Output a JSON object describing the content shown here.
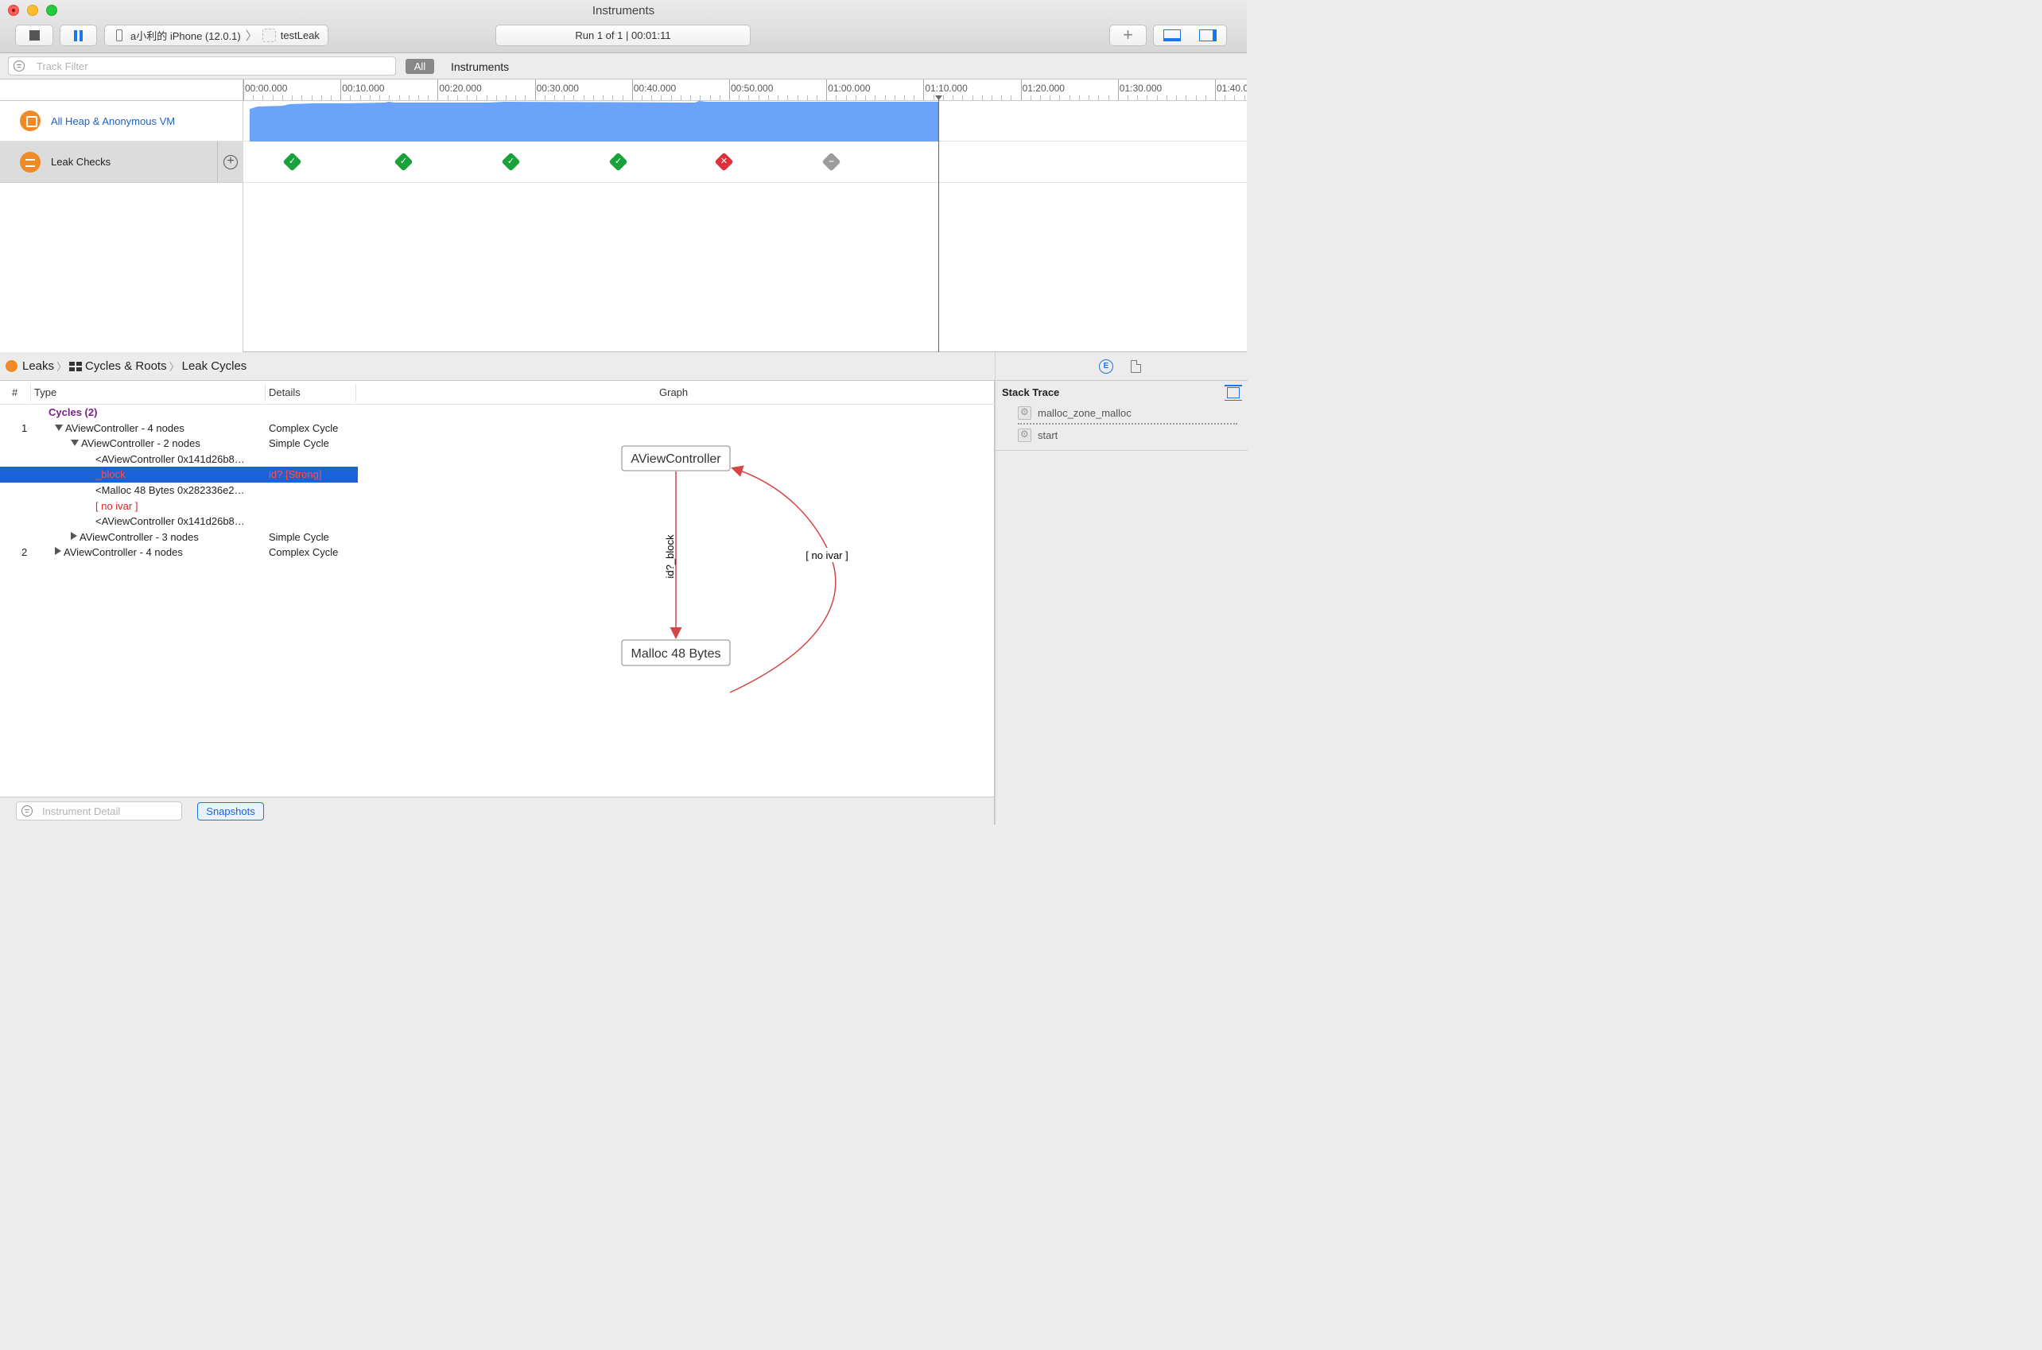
{
  "window": {
    "title": "Instruments"
  },
  "toolbar": {
    "device": "a小利的 iPhone (12.0.1)",
    "target": "testLeak",
    "run_status": "Run 1 of 1  |  00:01:11"
  },
  "filterbar": {
    "track_filter_placeholder": "Track Filter",
    "all_label": "All",
    "instruments_label": "Instruments"
  },
  "timeline": {
    "ticks": [
      "00:00.000",
      "00:10.000",
      "00:20.000",
      "00:30.000",
      "00:40.000",
      "00:50.000",
      "01:00.000",
      "01:10.000",
      "01:20.000",
      "01:30.000",
      "01:40.0"
    ],
    "tracks": [
      {
        "name": "All Heap & Anonymous VM"
      },
      {
        "name": "Leak Checks"
      }
    ],
    "leak_checks": [
      "ok",
      "ok",
      "ok",
      "ok",
      "leak",
      "none"
    ]
  },
  "detail": {
    "breadcrumb": [
      "Leaks",
      "Cycles & Roots",
      "Leak Cycles"
    ],
    "columns": {
      "num": "#",
      "type": "Type",
      "details": "Details",
      "graph": "Graph"
    },
    "rows": [
      {
        "num": "",
        "type": "Cycles (2)",
        "details": ""
      },
      {
        "num": "1",
        "type": "AViewController - 4 nodes",
        "details": "Complex Cycle"
      },
      {
        "num": "",
        "type": "AViewController - 2 nodes",
        "details": "Simple Cycle"
      },
      {
        "num": "",
        "type": "<AViewController 0x141d26b8…",
        "details": ""
      },
      {
        "num": "",
        "type": "_block",
        "details": "id?  [Strong]"
      },
      {
        "num": "",
        "type": "<Malloc 48 Bytes 0x282336e2…",
        "details": ""
      },
      {
        "num": "",
        "type": "[ no ivar ]",
        "details": ""
      },
      {
        "num": "",
        "type": "<AViewController 0x141d26b8…",
        "details": ""
      },
      {
        "num": "",
        "type": "AViewController - 3 nodes",
        "details": "Simple Cycle"
      },
      {
        "num": "2",
        "type": "AViewController - 4 nodes",
        "details": "Complex Cycle"
      }
    ],
    "graph": {
      "node_top": "AViewController",
      "node_bottom": "Malloc 48 Bytes",
      "edge_down_label": "id?_block",
      "edge_up_label": "[ no ivar ]"
    },
    "instrument_detail_placeholder": "Instrument Detail",
    "snapshots_label": "Snapshots"
  },
  "inspector": {
    "stack_trace_title": "Stack Trace",
    "frames": [
      "malloc_zone_malloc",
      "start"
    ]
  },
  "colors": {
    "accent": "#1b76e8",
    "heap_fill": "#6aa3f8",
    "selection": "#1b62d8",
    "leak_ok": "#19a13a",
    "leak_bad": "#e0313b",
    "edge": "#d64545"
  }
}
